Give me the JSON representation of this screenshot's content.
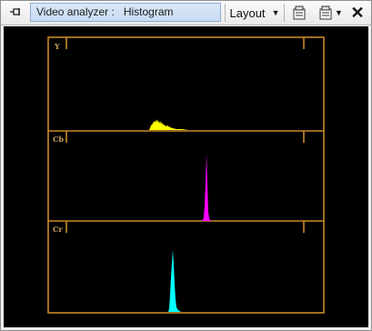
{
  "toolbar": {
    "pin_icon": "pin-icon",
    "title": "Video analyzer :   Histogram",
    "layout_label": "Layout",
    "layout_caret": "▼",
    "props_icon": "properties-icon",
    "close_icon": "close-icon"
  },
  "histogram": {
    "frame_color": "#c8892a",
    "channels": [
      {
        "label": "Y",
        "color": "#ffff00"
      },
      {
        "label": "Cb",
        "color": "#ff00ff"
      },
      {
        "label": "Cr",
        "color": "#00ffff"
      }
    ]
  }
}
